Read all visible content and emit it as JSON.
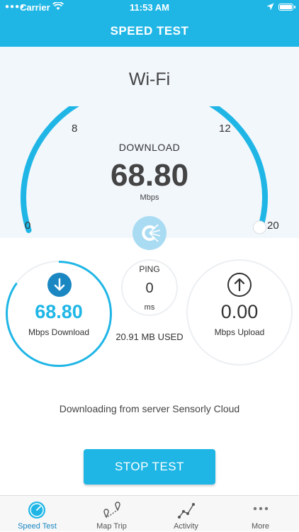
{
  "status_bar": {
    "carrier": "Carrier",
    "time": "11:53 AM"
  },
  "header": {
    "title": "SPEED TEST"
  },
  "gauge": {
    "network": "Wi-Fi",
    "label": "DOWNLOAD",
    "value": "68.80",
    "unit": "Mbps",
    "ticks": [
      "0",
      "8",
      "12",
      "20"
    ],
    "fill_fraction": 1.0
  },
  "download": {
    "value": "68.80",
    "label": "Mbps Download",
    "progress": 0.85
  },
  "ping": {
    "label": "PING",
    "value": "0",
    "unit": "ms"
  },
  "data_used": "20.91 MB USED",
  "upload": {
    "value": "0.00",
    "label": "Mbps Upload"
  },
  "server_text": "Downloading from server Sensorly Cloud",
  "stop_button": "STOP TEST",
  "tabs": [
    {
      "label": "Speed Test",
      "icon": "speedometer-icon",
      "active": true
    },
    {
      "label": "Map Trip",
      "icon": "map-trip-icon",
      "active": false
    },
    {
      "label": "Activity",
      "icon": "activity-icon",
      "active": false
    },
    {
      "label": "More",
      "icon": "more-icon",
      "active": false
    }
  ],
  "colors": {
    "accent": "#1fb6e6",
    "dark_accent": "#1a87c2",
    "gauge_bg": "#f2f7fc"
  }
}
